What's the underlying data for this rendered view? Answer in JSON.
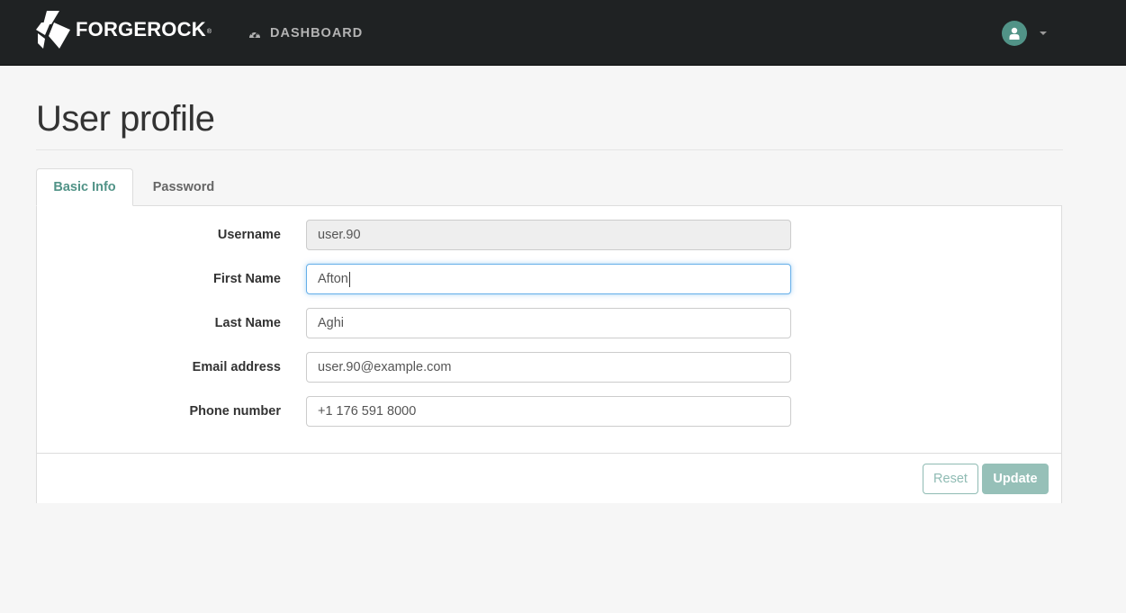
{
  "header": {
    "logo_text": "FORGEROCK",
    "logo_reg": "®",
    "nav_dashboard_label": "DASHBOARD",
    "colors": {
      "background": "#1f2223",
      "accent": "#519387"
    },
    "icons": {
      "dashboard": "speedometer-icon",
      "user": "user-icon",
      "menu": "caret-down-icon"
    }
  },
  "page": {
    "title": "User profile"
  },
  "tabs": [
    {
      "label": "Basic Info",
      "active": true
    },
    {
      "label": "Password",
      "active": false
    }
  ],
  "form": {
    "fields": [
      {
        "label": "Username",
        "value": "user.90",
        "readonly": true
      },
      {
        "label": "First Name",
        "value": "Afton",
        "focused": true
      },
      {
        "label": "Last Name",
        "value": "Aghi"
      },
      {
        "label": "Email address",
        "value": "user.90@example.com"
      },
      {
        "label": "Phone number",
        "value": "+1 176 591 8000"
      }
    ]
  },
  "actions": {
    "reset_label": "Reset",
    "update_label": "Update"
  }
}
